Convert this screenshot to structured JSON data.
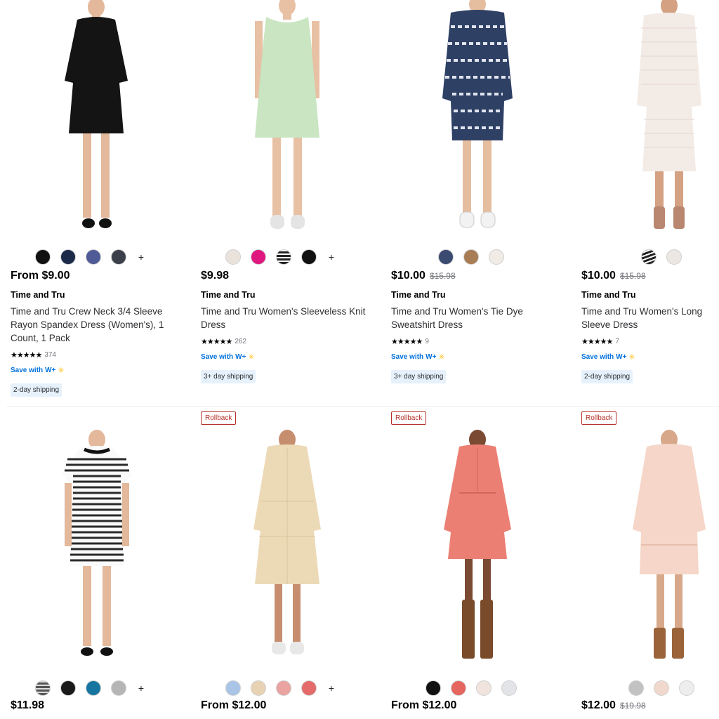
{
  "products_row1": [
    {
      "swatch_colors": [
        "#111111",
        "#1c2a4a",
        "#4f5a96",
        "#3b3f49"
      ],
      "more_swatches": "+",
      "price": "From $9.00",
      "was_price": "",
      "brand": "Time and Tru",
      "title": "Time and Tru Crew Neck 3/4 Sleeve Rayon Spandex Dress (Women's), 1 Count, 1 Pack",
      "rating_stars": "★★★★★",
      "review_count": "374",
      "save_label": "Save with",
      "save_brand": "W+",
      "shipping": "2-day shipping"
    },
    {
      "swatch_colors": [
        "#e9e3dc",
        "#e0177f",
        "#222222",
        "#111111"
      ],
      "more_swatches": "+",
      "price": "$9.98",
      "was_price": "",
      "brand": "Time and Tru",
      "title": "Time and Tru Women's Sleeveless Knit Dress",
      "rating_stars": "★★★★★",
      "review_count": "262",
      "save_label": "Save with",
      "save_brand": "W+",
      "shipping": "3+ day shipping"
    },
    {
      "swatch_colors": [
        "#3a4a70",
        "#a87c55",
        "#f0ebe5"
      ],
      "more_swatches": "",
      "price": "$10.00",
      "was_price": "$15.98",
      "brand": "Time and Tru",
      "title": "Time and Tru Women's Tie Dye Sweatshirt Dress",
      "rating_stars": "★★★★★",
      "review_count": "9",
      "save_label": "Save with",
      "save_brand": "W+",
      "shipping": "3+ day shipping"
    },
    {
      "swatch_colors": [
        "#222222",
        "#ece7e3"
      ],
      "more_swatches": "",
      "price": "$10.00",
      "was_price": "$15.98",
      "brand": "Time and Tru",
      "title": "Time and Tru Women's Long Sleeve Dress",
      "rating_stars": "★★★★★",
      "review_count": "7",
      "save_label": "Save with",
      "save_brand": "W+",
      "shipping": "2-day shipping"
    }
  ],
  "products_row2": [
    {
      "badge": "",
      "swatch_colors": [
        "#555555",
        "#1a1a1a",
        "#1676a0",
        "#b5b5b5"
      ],
      "more_swatches": "+",
      "price": "$11.98",
      "was_price": ""
    },
    {
      "badge": "Rollback",
      "swatch_colors": [
        "#a9c4e6",
        "#e7d2b4",
        "#e9a3a0",
        "#e56b6b"
      ],
      "more_swatches": "+",
      "price": "From $12.00",
      "was_price": ""
    },
    {
      "badge": "Rollback",
      "swatch_colors": [
        "#111111",
        "#e5655f",
        "#f1e4de",
        "#e2e4e8"
      ],
      "more_swatches": "",
      "price": "From $12.00",
      "was_price": ""
    },
    {
      "badge": "Rollback",
      "swatch_colors": [
        "#c2c2c2",
        "#f1d8cc",
        "#eeeeee"
      ],
      "more_swatches": "",
      "price": "$12.00",
      "was_price": "$19.98"
    }
  ],
  "images": [
    {
      "icon": "black-dress-photo",
      "dress_color": "#141414",
      "skin": "#e3b89b",
      "shoe": "#111111"
    },
    {
      "icon": "mint-dress-photo",
      "dress_color": "#c9e5c2",
      "skin": "#e8c0a4",
      "shoe": "#e4e4e4"
    },
    {
      "icon": "tiedye-dress-photo",
      "dress_color": "#2f4065",
      "skin": "#e5bd9f",
      "shoe": "#f2f2f2"
    },
    {
      "icon": "stripe-dress-photo",
      "dress_color": "#f3ebe6",
      "skin": "#d4a183",
      "shoe": "#b98670"
    },
    {
      "icon": "striped-tshirt-dress-photo",
      "dress_color": "#2a2a2a",
      "skin": "#e3b89b",
      "shoe": "#111111"
    },
    {
      "icon": "beige-shirt-dress-photo",
      "dress_color": "#ecd9b6",
      "skin": "#c68e6f",
      "shoe": "#e8e8e8"
    },
    {
      "icon": "coral-dress-photo",
      "dress_color": "#ec7f73",
      "skin": "#7a4a33",
      "shoe": "#7a4b2a"
    },
    {
      "icon": "peach-sweatshirt-dress-photo",
      "dress_color": "#f5d6c8",
      "skin": "#d8a88a",
      "shoe": "#9a633a"
    }
  ],
  "colors": {
    "accent_blue": "#0071dc",
    "rollback_red": "#b5312a",
    "walmart_yellow": "#ffc220"
  }
}
